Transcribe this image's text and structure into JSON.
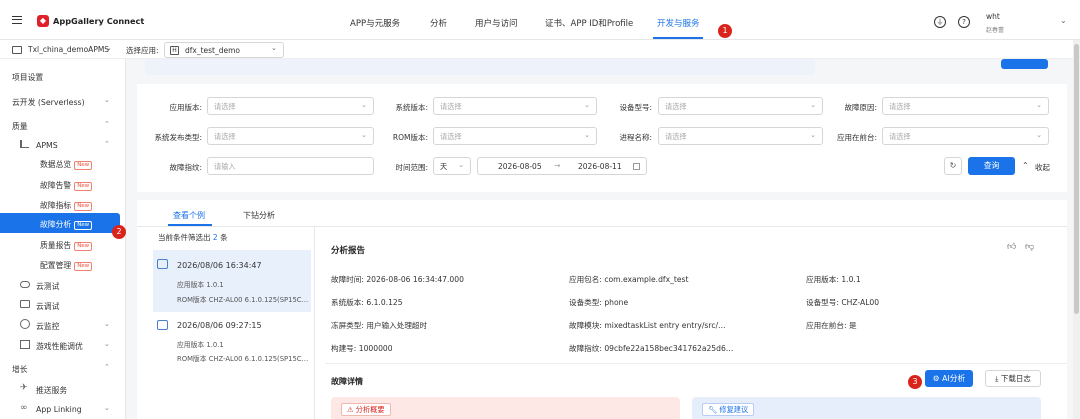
{
  "header": {
    "app_title": "AppGallery Connect",
    "nav": [
      "APP与元服务",
      "分析",
      "用户与访问",
      "证书、APP ID和Profile",
      "开发与服务"
    ],
    "user_name": "wht",
    "user_sub": "赵春蕾",
    "badge_1": "1"
  },
  "sub_header": {
    "project": "Txl_china_demoAPMS",
    "select_app_label": "选择应用:",
    "app_tag": "H",
    "app_name": "dfx_test_demo"
  },
  "sidebar": {
    "project_settings": "项目设置",
    "cloud_dev": "云开发 (Serverless)",
    "quality": "质量",
    "apms": "APMS",
    "data_overview": "数据总览",
    "fault_alert": "故障告警",
    "fault_metrics": "故障指标",
    "fault_analysis": "故障分析",
    "quality_report": "质量报告",
    "config_manage": "配置管理",
    "cloud_test": "云测试",
    "cloud_debug": "云调试",
    "cloud_monitor": "云监控",
    "game_perf": "游戏性能调优",
    "growth": "增长",
    "push": "推送服务",
    "app_linking": "App Linking",
    "new_tag": "New",
    "badge_2": "2"
  },
  "filters": {
    "app_version": "应用版本:",
    "system_version": "系统版本:",
    "device_model": "设备型号:",
    "fault_reason": "故障原因:",
    "system_release_type": "系统发布类型:",
    "rom_version": "ROM版本:",
    "process_name": "进程名称:",
    "app_foreground": "应用在前台:",
    "fault_fingerprint": "故障指纹:",
    "time_range": "时间范围:",
    "placeholder_select": "请选择",
    "placeholder_input": "请输入",
    "time_unit": "天",
    "date_start": "2026-08-05",
    "date_sep": "→",
    "date_end": "2026-08-11",
    "query": "查询",
    "collapse": "收起"
  },
  "tabs": [
    "查看个例",
    "下钻分析"
  ],
  "list": {
    "summary_prefix": "当前条件筛选出",
    "count": "2",
    "summary_suffix": "条",
    "items": [
      {
        "time": "2026/08/06 16:34:47",
        "app_version": "应用版本  1.0.1",
        "rom": "ROM版本  CHZ-AL00 6.1.0.125(SP15C…"
      },
      {
        "time": "2026/08/06 09:27:15",
        "app_version": "应用版本  1.0.1",
        "rom": "ROM版本  CHZ-AL00 6.1.0.125(SP15C…"
      }
    ]
  },
  "report": {
    "title": "分析报告",
    "fields": [
      "故障时间:  2026-08-06 16:34:47.000",
      "应用包名:  com.example.dfx_test",
      "应用版本:  1.0.1",
      "系统版本:  6.1.0.125",
      "设备类型:  phone",
      "设备型号:  CHZ-AL00",
      "冻屏类型:  用户输入处理超时",
      "故障模块:  mixedtaskList entry entry/src/…",
      "应用在前台:  是",
      "构建号:  1000000",
      "故障指纹:  09cbfe22a158bec341762a25d6…"
    ],
    "detail_title": "故障详情",
    "ai_btn": "AI分析",
    "download_btn": "下载日志",
    "badge_3": "3",
    "overview": "分析概要",
    "suggestion": "修复建议"
  },
  "colors": {
    "accent": "#1a73e8",
    "brand": "#e0202b",
    "badge": "#d9241c"
  }
}
